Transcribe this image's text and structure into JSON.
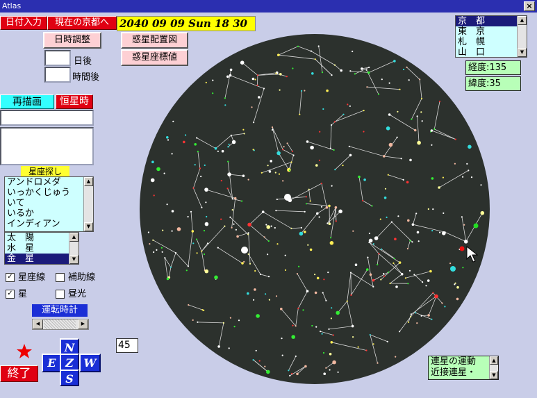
{
  "window": {
    "title": "Atlas",
    "close": "×"
  },
  "toolbar": {
    "date_input": "日付入力",
    "current_kyoto": "現在の京都へ",
    "datetime": "2040 09 09 Sun 18 30",
    "adjust": "日時調整",
    "planet_layout": "惑星配置図",
    "planet_coords": "惑星座標値"
  },
  "offset": {
    "days_label": "日後",
    "hours_label": "時間後",
    "days_value": "",
    "hours_value": ""
  },
  "buttons": {
    "redraw": "再描画",
    "sidereal": "恒星時",
    "exit": "終了"
  },
  "constellation": {
    "search_label": "星座探し",
    "items": [
      "アンドロメダ",
      "いっかくじゅう",
      "いて",
      "いるか",
      "インディアン"
    ]
  },
  "planets": {
    "items": [
      "太　陽",
      "水　星",
      "金　星"
    ],
    "selected": 2
  },
  "cities": {
    "items": [
      "京　都",
      "東　京",
      "札　幌",
      "山　口"
    ],
    "selected": 0
  },
  "coords": {
    "longitude": "経度:135",
    "latitude": "緯度:35"
  },
  "options": {
    "constellation_lines": "星座線",
    "aux_lines": "補助線",
    "stars": "星",
    "daylight": "昼光",
    "constellation_lines_checked": true,
    "aux_lines_checked": false,
    "stars_checked": true,
    "daylight_checked": false
  },
  "run_clock": {
    "label": "運転時計"
  },
  "speed_value": "45",
  "compass": {
    "n": "N",
    "e": "E",
    "z": "Z",
    "w": "W",
    "s": "S"
  },
  "binary": {
    "items": [
      "連星の運動",
      "近接連星・"
    ]
  },
  "icons": {
    "star": "red-star-icon"
  },
  "colors": {
    "sky": "#2c312d",
    "background": "#c9cde8",
    "red": "#e00012",
    "list": "#ceffff",
    "green_box": "#b8ffb8"
  }
}
